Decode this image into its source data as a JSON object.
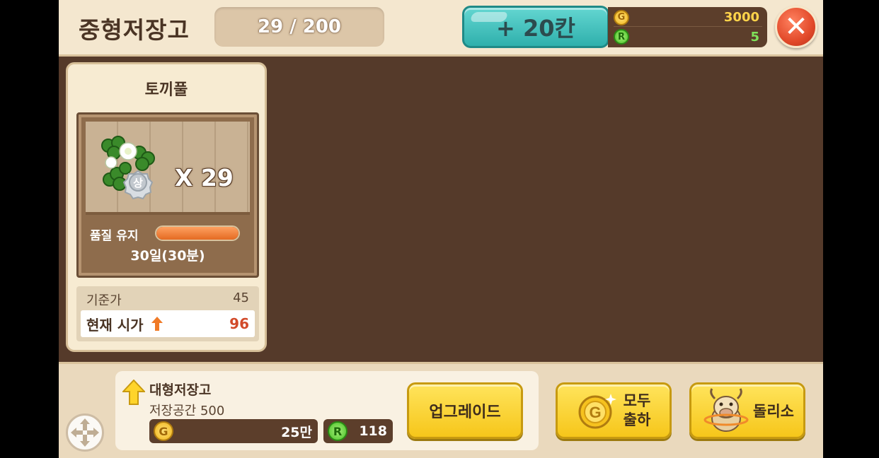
{
  "header": {
    "title": "중형저장고",
    "capacity": "29 / 200",
    "expand_label": "+ 20칸",
    "gold": "3000",
    "ruby": "5",
    "gold_symbol": "G",
    "ruby_symbol": "R",
    "close_symbol": "✕"
  },
  "item": {
    "name": "토끼풀",
    "quantity": "X 29",
    "grade_badge": "상",
    "quality_label": "품질 유지",
    "quality_level": 1.0,
    "duration": "30일(30분)",
    "base_price_label": "기준가",
    "base_price": "45",
    "current_price_label": "현재 시가",
    "current_price": "96",
    "trend": "up"
  },
  "upgrade": {
    "name": "대형저장고",
    "storage": "저장공간 500",
    "gold_cost": "25만",
    "ruby_cost": "118",
    "button_label": "업그레이드"
  },
  "actions": {
    "ship_all_line1": "모두",
    "ship_all_line2": "출하",
    "roulette_label": "돌리소"
  },
  "colors": {
    "background": "#553a2a",
    "header": "#f4e7cf",
    "expand_button": "#3fc1bd",
    "close_button": "#e24a2a",
    "yellow_button": "#f6c61a",
    "price_up": "#d24a2a"
  }
}
